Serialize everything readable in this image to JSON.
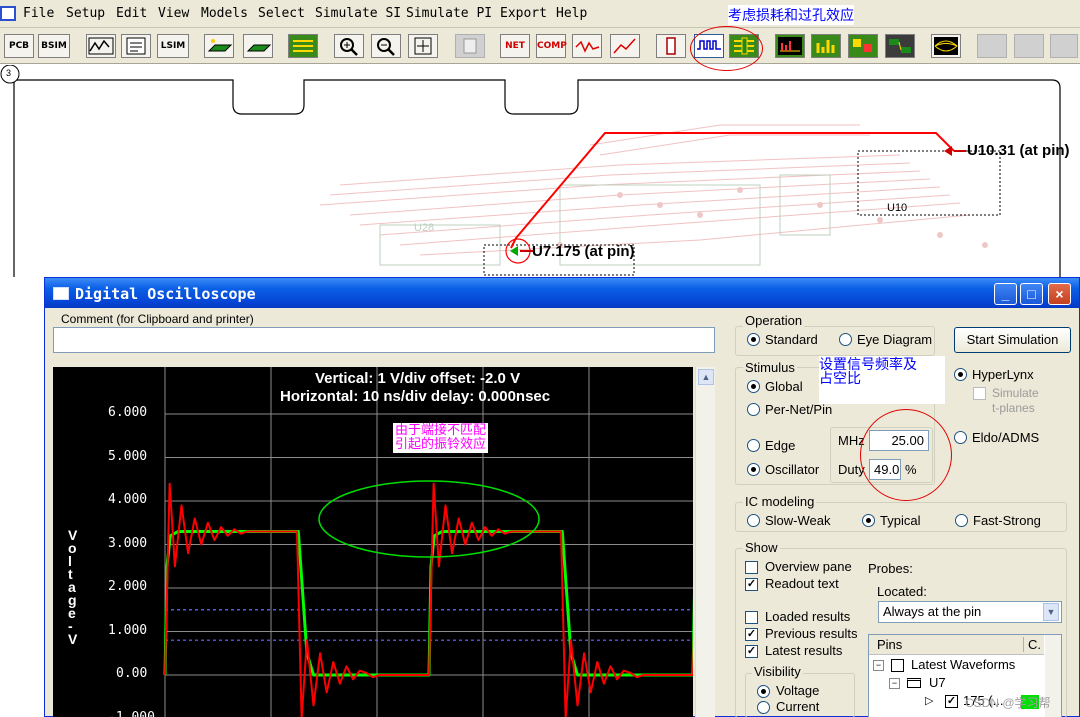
{
  "menu": {
    "items": [
      "File",
      "Setup",
      "Edit",
      "View",
      "Models",
      "Select",
      "Simulate SI",
      "Simulate PI",
      "Export",
      "Help"
    ]
  },
  "annotations": {
    "toolbar_note": "考虑损耗和过孔效应",
    "stimulus_note_line1": "设置信号频率及",
    "stimulus_note_line2": "占空比",
    "scope_note_line1": "由于端接不匹配",
    "scope_note_line2": "引起的振铃效应"
  },
  "toolbar": {
    "pcb": "PCB",
    "bsim": "BSIM",
    "lsim": "LSIM",
    "net": "NET",
    "comp": "COMP"
  },
  "board": {
    "tab_number": "3",
    "net_label_u10": "U10.31 (at pin)",
    "net_label_u7": "U7.175 (at pin)",
    "ref_u10": "U10",
    "ref_u28": "U28"
  },
  "scope_window": {
    "title": "Digital Oscilloscope",
    "comment_label": "Comment (for Clipboard and printer)",
    "comment_value": "",
    "scope": {
      "vertical_readout": "Vertical: 1  V/div  offset: -2.0 V",
      "horizontal_readout": "Horizontal: 10 ns/div  delay: 0.000nsec",
      "y_axis_label": [
        "V",
        "o",
        "l",
        "t",
        "a",
        "g",
        "e",
        "-",
        "V"
      ],
      "y_ticks": [
        "6.000",
        "5.000",
        "4.000",
        "3.000",
        "2.000",
        "1.000",
        "0.00",
        "-1.000"
      ]
    },
    "operation": {
      "title": "Operation",
      "standard": "Standard",
      "eye_diagram": "Eye Diagram",
      "selected": "Standard"
    },
    "start_simulation": "Start Simulation",
    "stimulus": {
      "title": "Stimulus",
      "global": "Global",
      "per_net_pin": "Per-Net/Pin",
      "edge": "Edge",
      "oscillator": "Oscillator",
      "mhz_label": "MHz",
      "mhz_value": "25.00",
      "duty_label": "Duty",
      "duty_value": "49.0",
      "duty_unit": "%"
    },
    "simulator": {
      "hyperlynx": "HyperLynx",
      "simulate_tplanes_line1": "Simulate",
      "simulate_tplanes_line2": "t-planes",
      "eldo_adms": "Eldo/ADMS"
    },
    "ic_modeling": {
      "title": "IC modeling",
      "slow_weak": "Slow-Weak",
      "typical": "Typical",
      "fast_strong": "Fast-Strong",
      "selected": "Typical"
    },
    "show": {
      "title": "Show",
      "overview_pane": "Overview pane",
      "readout_text": "Readout text",
      "loaded_results": "Loaded results",
      "previous_results": "Previous results",
      "latest_results": "Latest results"
    },
    "visibility": {
      "title": "Visibility",
      "voltage": "Voltage",
      "current": "Current"
    },
    "probes": {
      "title": "Probes:",
      "located_label": "Located:",
      "located_value": "Always at the pin",
      "col_pins": "Pins",
      "col_c": "C.",
      "tree_root": "Latest Waveforms",
      "tree_u7": "U7",
      "tree_pin": "175 (..."
    }
  },
  "watermark": "CSDN @学习帮",
  "chart_data": {
    "type": "line",
    "title": "",
    "xlabel": "",
    "ylabel": "Voltage -V",
    "ylim": [
      -1.0,
      6.5
    ],
    "xlim": [
      0,
      80
    ],
    "grid": true,
    "series": [
      {
        "color": "#00ff00",
        "x": [
          0,
          0.3,
          0.8,
          2,
          20.2,
          21.5,
          22.5,
          40,
          40.3,
          40.8,
          42,
          60.2,
          61.5,
          62.5,
          80,
          80.3
        ],
        "y": [
          0.0,
          2.5,
          3.2,
          3.3,
          3.3,
          0.5,
          0.0,
          0.0,
          2.5,
          3.2,
          3.3,
          3.3,
          0.5,
          0.0,
          0.0,
          2.5
        ]
      },
      {
        "color": "#ff0000",
        "x": [
          0,
          0.7,
          1.5,
          2.5,
          3.5,
          4.5,
          5.5,
          6.5,
          7.5,
          8.5,
          9.5,
          10.5,
          11.5,
          12.5,
          20,
          20.7,
          21.5,
          22.5,
          23.5,
          24.5,
          25.5,
          26.5,
          27.5,
          28.5,
          29.5,
          30.5,
          31.5,
          32.5,
          40,
          40.7,
          41.5,
          42.5,
          43.5,
          44.5,
          45.5,
          46.5,
          47.5,
          48.5,
          49.5,
          50.5,
          51.5,
          52.5,
          60,
          60.7,
          61.5,
          62.5,
          63.5,
          64.5,
          65.5,
          66.5,
          67.5,
          68.5,
          69.5,
          70.5,
          71.5,
          72.5,
          80,
          80.7
        ],
        "y": [
          0.0,
          4.4,
          2.5,
          3.9,
          2.8,
          3.6,
          3.0,
          3.5,
          3.1,
          3.4,
          3.2,
          3.35,
          3.25,
          3.3,
          3.3,
          -1.0,
          0.8,
          -0.7,
          0.5,
          -0.4,
          0.3,
          -0.2,
          0.2,
          -0.1,
          0.1,
          0.05,
          -0.05,
          0.0,
          0.0,
          4.4,
          2.5,
          3.9,
          2.8,
          3.6,
          3.0,
          3.5,
          3.1,
          3.4,
          3.2,
          3.35,
          3.25,
          3.3,
          3.3,
          -1.0,
          0.8,
          -0.7,
          0.5,
          -0.4,
          0.3,
          -0.2,
          0.2,
          -0.1,
          0.1,
          0.05,
          -0.05,
          0.0,
          0.0,
          4.4
        ]
      }
    ],
    "reference_lines": [
      1.5,
      0.8
    ]
  }
}
